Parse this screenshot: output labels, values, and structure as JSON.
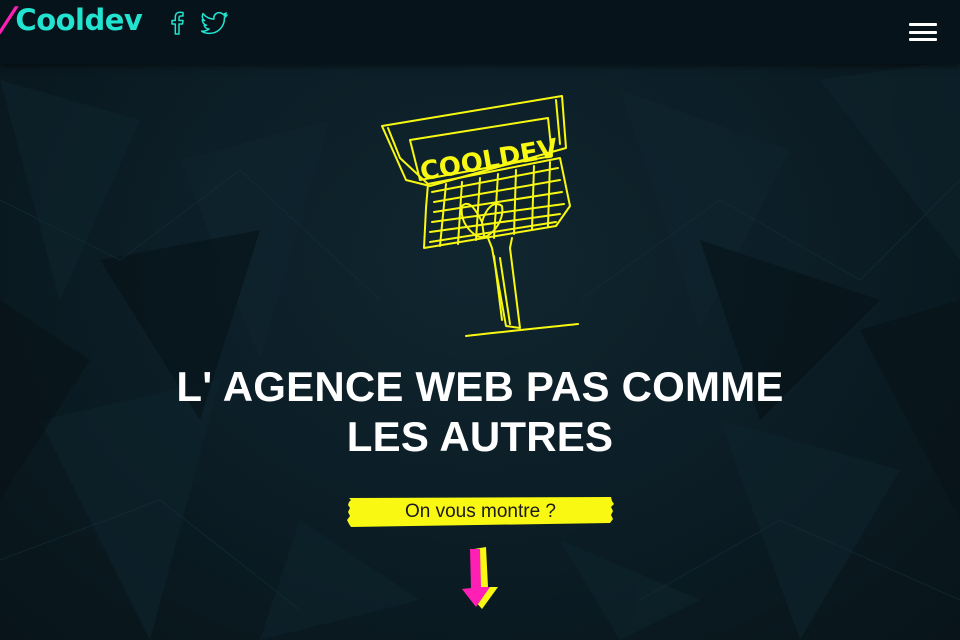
{
  "header": {
    "logo_slash": "/",
    "logo_text": "Cooldev",
    "social": [
      {
        "icon": "facebook-icon"
      },
      {
        "icon": "twitter-icon"
      }
    ],
    "menu_icon": "hamburger-menu-icon"
  },
  "hero": {
    "sign_text": "COOLDEV",
    "title": "L' AGENCE WEB PAS COMME LES AUTRES",
    "cta_label": "On vous montre ?",
    "scroll_icon": "arrow-down-icon"
  },
  "colors": {
    "background": "#0a1a22",
    "header_bg": "#06131a",
    "accent_pink": "#ff1fb4",
    "accent_teal": "#22e3d0",
    "accent_yellow": "#f8f812",
    "text": "#ffffff"
  }
}
